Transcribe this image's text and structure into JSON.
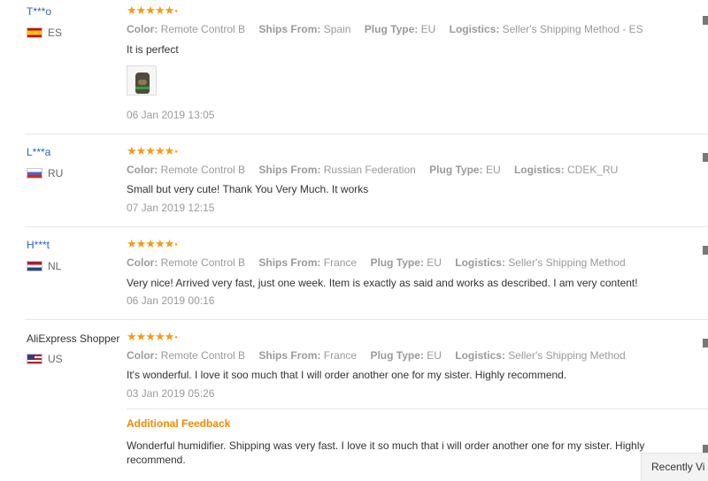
{
  "labels": {
    "color": "Color:",
    "ships_from": "Ships From:",
    "plug_type": "Plug Type:",
    "logistics": "Logistics:"
  },
  "reviews": [
    {
      "user": "T***o",
      "country": "ES",
      "stars": 5,
      "stars_text": "★★★★★",
      "color": "Remote Control B",
      "ships_from": "Spain",
      "plug_type": "EU",
      "logistics": "Seller's Shipping Method - ES",
      "text": "It is perfect",
      "date": "06 Jan 2019 13:05"
    },
    {
      "user": "L***a",
      "country": "RU",
      "stars": 5,
      "stars_text": "★★★★★",
      "color": "Remote Control B",
      "ships_from": "Russian Federation",
      "plug_type": "EU",
      "logistics": "CDEK_RU",
      "text": "Small but very cute! Thank You Very Much. It works",
      "date": "07 Jan 2019 12:15"
    },
    {
      "user": "H***t",
      "country": "NL",
      "stars": 5,
      "stars_text": "★★★★★",
      "color": "Remote Control B",
      "ships_from": "France",
      "plug_type": "EU",
      "logistics": "Seller's Shipping Method",
      "text": "Very nice! Arrived very fast, just one week. Item is exactly as said and works as described. I am very content!",
      "date": "06 Jan 2019 00:16"
    },
    {
      "user": "AliExpress Shopper",
      "country": "US",
      "stars": 5,
      "stars_text": "★★★★★",
      "color": "Remote Control B",
      "ships_from": "France",
      "plug_type": "EU",
      "logistics": "Seller's Shipping Method",
      "text": "It's wonderful. I love it soo much that I will order another one for my sister. Highly recommend.",
      "date": "03 Jan 2019 05:26",
      "additional_feedback_title": "Additional Feedback",
      "additional_feedback_text": "Wonderful humidifier. Shipping was very fast. I love it so much that i will order another one for my sister. Highly recommend."
    }
  ],
  "recently_viewed_label": "Recently Vi",
  "icons": {
    "star": "star-icon",
    "photo": "review-photo"
  },
  "colors": {
    "username_link": "#2764c8",
    "star": "#f39c12",
    "additional_feedback": "#f28a00",
    "meta_grey": "#9a9a9a"
  }
}
